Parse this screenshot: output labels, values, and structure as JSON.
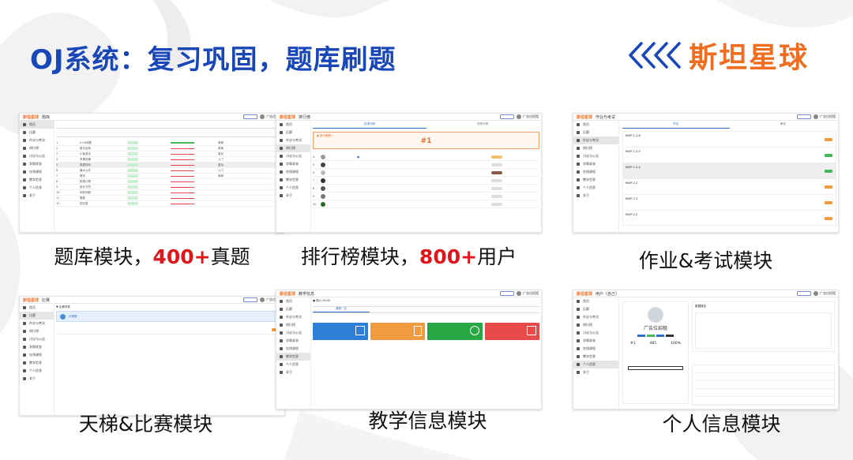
{
  "title": "OJ系统：复习巩固，题库刷题",
  "logo": {
    "text": "斯坦星球",
    "icon": "chevrons-icon",
    "color": "#ef6d21"
  },
  "colors": {
    "title": "#1a47b8",
    "highlight": "#e0161d",
    "brand": "#ef6d21"
  },
  "panels": [
    {
      "caption_prefix": "题库模块，",
      "caption_highlight": "400+",
      "caption_suffix": "真题",
      "page_name": "题库"
    },
    {
      "caption_prefix": "排行榜模块，",
      "caption_highlight": "800+",
      "caption_suffix": "用户",
      "page_name": "排行榜",
      "rank_label": "#1"
    },
    {
      "caption": "作业&考试模块",
      "page_name": "作业与考试",
      "tabs": [
        "作业",
        "考试"
      ],
      "items": [
        "NOIP 1.2-6",
        "NOIP 1.2-5",
        "NOIP 1.2-4",
        "NOIP 2.2",
        "NOIP 2.3",
        "NOIP 2.2"
      ]
    },
    {
      "caption": "天梯&比赛模块",
      "page_name": "比赛"
    },
    {
      "caption": "教学信息模块",
      "page_name": "教学信息"
    },
    {
      "caption": "个人信息模块",
      "page_name": "用户（自己）",
      "profile_name": "广告位招租",
      "stats": [
        "#1",
        "485",
        "100%"
      ]
    }
  ],
  "sidebar": [
    "首页",
    "比赛",
    "作业与考试",
    "排行榜",
    "讨论与公告",
    "学情状态",
    "在线课程",
    "教学信息",
    "个人信息",
    "关于"
  ]
}
